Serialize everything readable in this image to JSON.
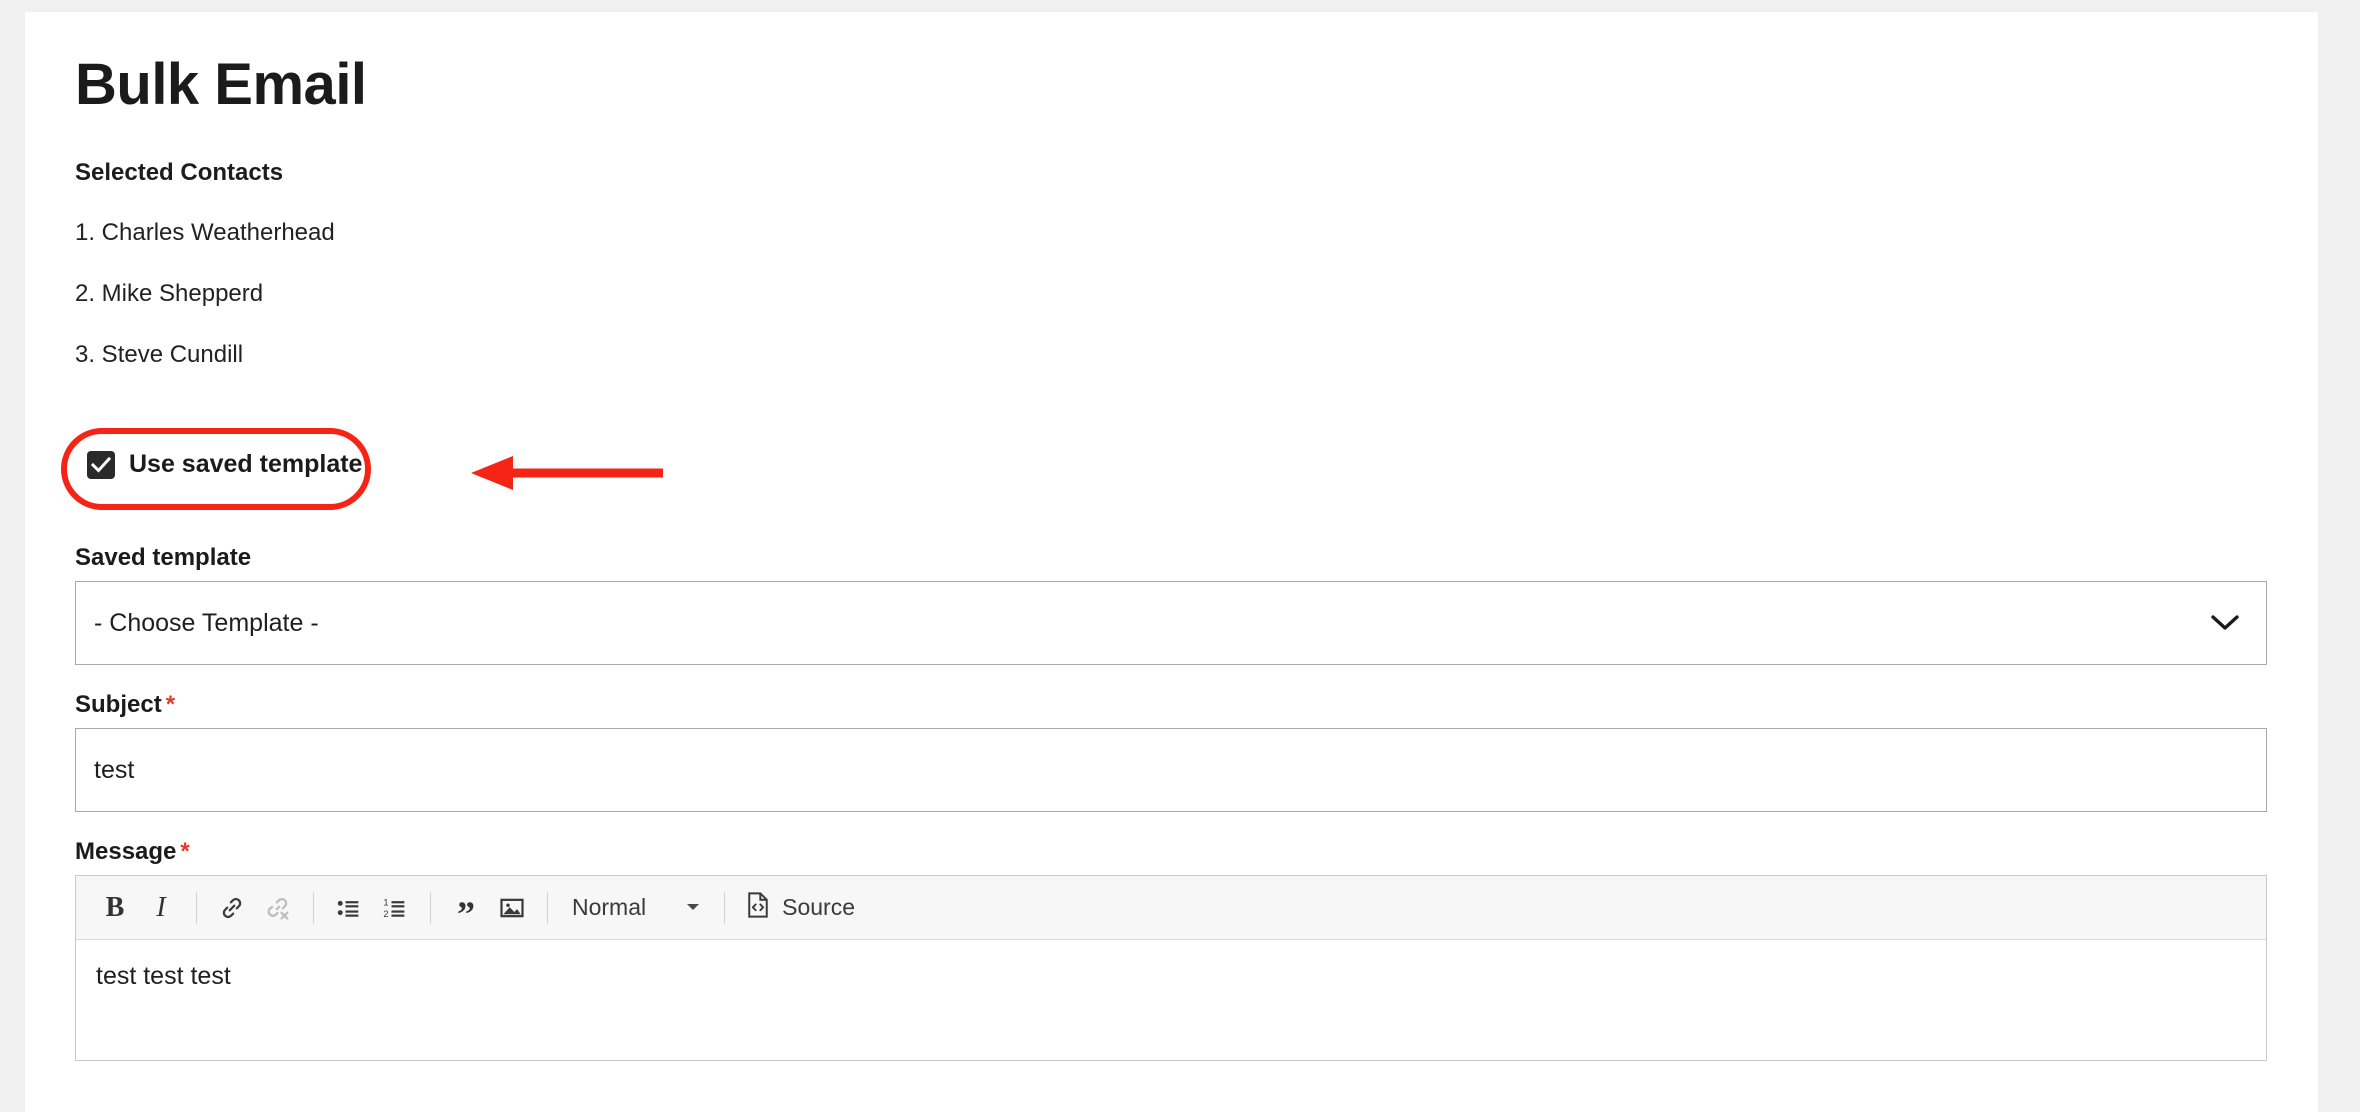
{
  "page": {
    "title": "Bulk Email",
    "background_color": "#f0f0f0",
    "card_color": "#ffffff"
  },
  "contacts_section": {
    "label": "Selected Contacts",
    "items": [
      "1. Charles Weatherhead",
      "2. Mike Shepperd",
      "3. Steve Cundill"
    ]
  },
  "use_saved_template": {
    "label": "Use saved template",
    "checked": true
  },
  "annotation": {
    "color": "#f52416",
    "shape": "rounded-rectangle-highlight",
    "arrow": "left-pointing-arrow"
  },
  "saved_template": {
    "label": "Saved template",
    "selected_option": "- Choose Template -",
    "chevron": "chevron-down-icon"
  },
  "subject": {
    "label": "Subject",
    "required_marker": "*",
    "value": "test",
    "placeholder": ""
  },
  "message": {
    "label": "Message",
    "required_marker": "*",
    "body": "test test test",
    "toolbar": {
      "bold": "B",
      "italic": "I",
      "link": "link-icon",
      "unlink": "unlink-icon",
      "bulleted_list": "bulleted-list-icon",
      "numbered_list": "numbered-list-icon",
      "blockquote": "quote-icon",
      "image": "image-icon",
      "style_label": "Normal",
      "style_caret": "caret-down-icon",
      "source_label": "Source",
      "source_icon": "source-code-icon"
    }
  },
  "colors": {
    "required_red": "#e8392b",
    "annotation_red": "#f52416",
    "checkbox_fill": "#2a2a2a",
    "toolbar_bg": "#f7f7f7",
    "border": "#a9a9a9"
  }
}
